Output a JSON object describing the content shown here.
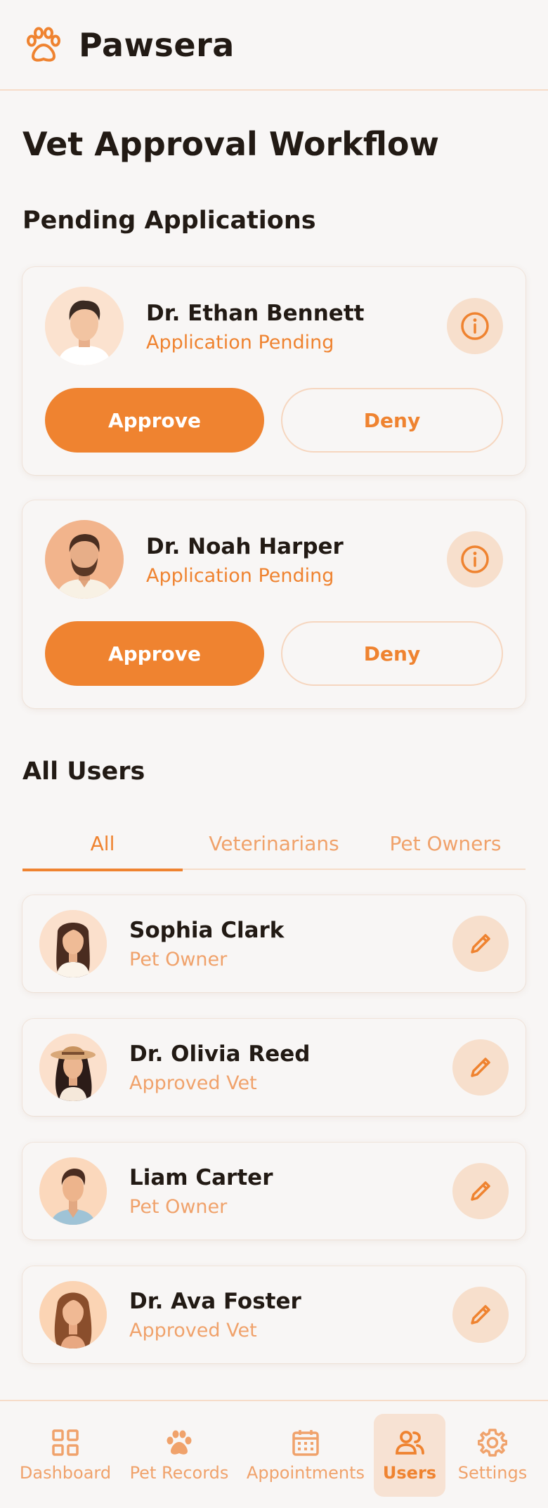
{
  "app": {
    "name": "Pawsera",
    "brand_icon": "paw-icon"
  },
  "page": {
    "title": "Vet Approval Workflow"
  },
  "pending": {
    "section_title": "Pending Applications",
    "applications": [
      {
        "name": "Dr. Ethan Bennett",
        "status": "Application Pending",
        "approve_label": "Approve",
        "deny_label": "Deny",
        "info_icon": "info-icon"
      },
      {
        "name": "Dr. Noah Harper",
        "status": "Application Pending",
        "approve_label": "Approve",
        "deny_label": "Deny",
        "info_icon": "info-icon"
      }
    ]
  },
  "users": {
    "section_title": "All Users",
    "tabs": [
      {
        "label": "All",
        "active": true
      },
      {
        "label": "Veterinarians",
        "active": false
      },
      {
        "label": "Pet Owners",
        "active": false
      }
    ],
    "list": [
      {
        "name": "Sophia Clark",
        "role": "Pet Owner",
        "action_icon": "pencil-icon"
      },
      {
        "name": "Dr. Olivia Reed",
        "role": "Approved Vet",
        "action_icon": "pencil-icon"
      },
      {
        "name": "Liam Carter",
        "role": "Pet Owner",
        "action_icon": "pencil-icon"
      },
      {
        "name": "Dr. Ava Foster",
        "role": "Approved Vet",
        "action_icon": "pencil-icon"
      }
    ]
  },
  "nav": {
    "items": [
      {
        "label": "Dashboard",
        "icon": "grid-icon",
        "active": false
      },
      {
        "label": "Pet Records",
        "icon": "paw-icon",
        "active": false
      },
      {
        "label": "Appointments",
        "icon": "calendar-icon",
        "active": false
      },
      {
        "label": "Users",
        "icon": "users-icon",
        "active": true
      },
      {
        "label": "Settings",
        "icon": "gear-icon",
        "active": false
      }
    ]
  },
  "colors": {
    "accent": "#ef8330",
    "accent_light": "#f7dfcc",
    "muted_accent": "#f0a26b",
    "background": "#f8f6f5",
    "text": "#221a14"
  }
}
